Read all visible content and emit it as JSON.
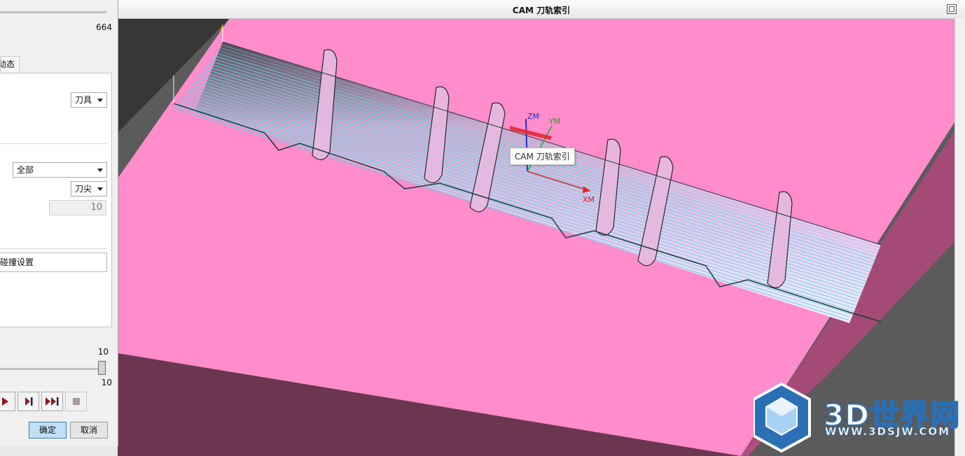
{
  "viewport": {
    "title": "CAM 刀轨索引",
    "tooltip": "CAM 刀轨索引",
    "axes": {
      "z": "ZM",
      "y": "YM",
      "x": "XM"
    }
  },
  "watermark": {
    "brand": "3D世界网",
    "url": "WWW.3DSJW.COM"
  },
  "panel": {
    "top_value": "664",
    "tab_label": "动态",
    "tool_combo": "刀具",
    "scope_combo": "全部",
    "point_combo": "刀尖",
    "number_field": "10",
    "collision_button": "碰撞设置",
    "slider_max": "10",
    "slider_current": "10",
    "slider_fraction": 1.0,
    "ok_label": "确定",
    "cancel_label": "取消"
  },
  "colors": {
    "part": "#ff8ccb",
    "toolpath": "#36e8f0",
    "accent": "#3c7fb1"
  }
}
